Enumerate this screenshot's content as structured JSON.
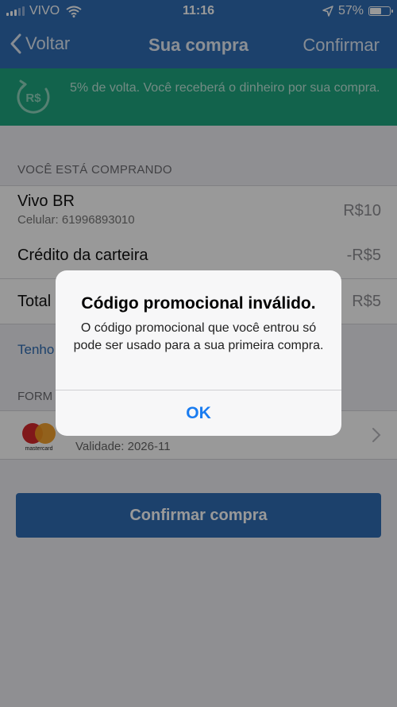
{
  "status_bar": {
    "carrier": "VIVO",
    "time": "11:16",
    "battery": "57%"
  },
  "nav": {
    "back_label": "Voltar",
    "title": "Sua compra",
    "confirm_label": "Confirmar"
  },
  "cashback": {
    "badge_text": "R$",
    "message": "5% de volta. Você receberá o dinheiro por sua compra."
  },
  "purchase": {
    "section_title": "VOCÊ ESTÁ COMPRANDO",
    "item": {
      "name": "Vivo BR",
      "detail": "Celular: 61996893010",
      "amount": "R$10"
    },
    "credit": {
      "label": "Crédito da carteira",
      "amount": "-R$5"
    },
    "total": {
      "label": "Total",
      "amount": "R$5"
    }
  },
  "promo_link": "Tenho",
  "payment": {
    "section_title": "FORM",
    "card_brand": "mastercard",
    "validity": "Validade: 2026-11"
  },
  "confirm_button": "Confirmar compra",
  "alert": {
    "title": "Código promocional inválido.",
    "message": "O código promocional que você entrou só pode ser usado para a sua primeira compra.",
    "ok_label": "OK"
  },
  "colors": {
    "primary": "#2f6db4",
    "cashback_green": "#1fa67f",
    "ios_blue": "#1a7cf0"
  }
}
